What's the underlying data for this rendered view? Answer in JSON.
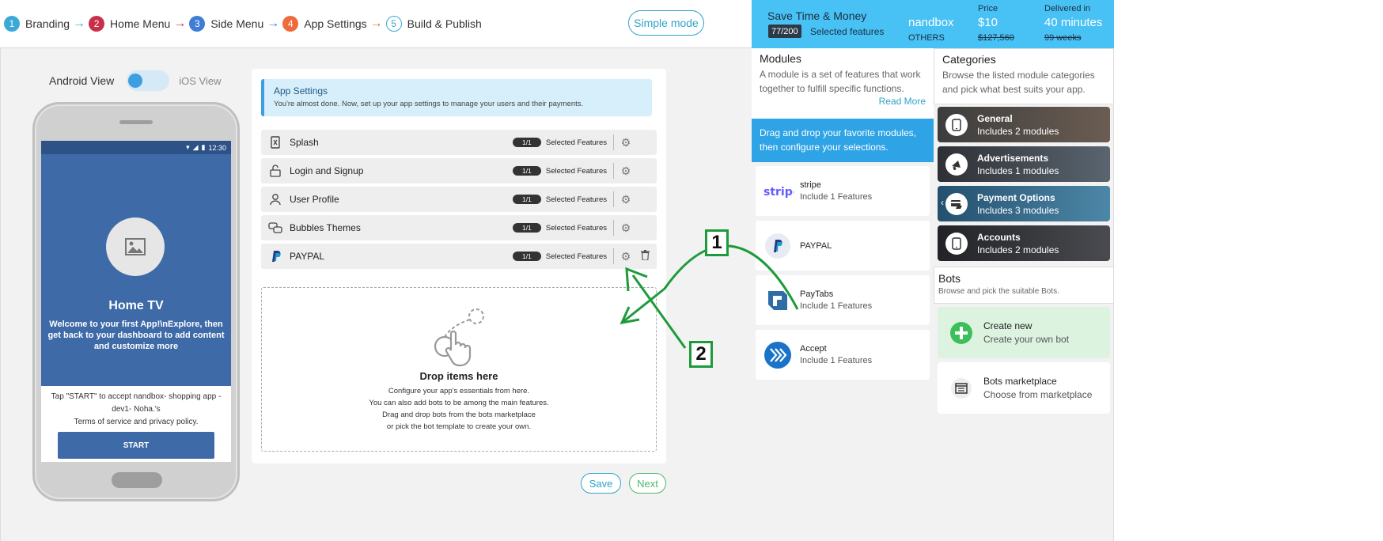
{
  "steps": [
    {
      "num": "1",
      "label": "Branding",
      "color": "#3aa9d6",
      "arrow": "→",
      "arrow_color": "#3aa9d6"
    },
    {
      "num": "2",
      "label": "Home Menu",
      "color": "#c8304a",
      "arrow": "→",
      "arrow_color": "#c8304a"
    },
    {
      "num": "3",
      "label": "Side Menu",
      "color": "#3e7cd6",
      "arrow": "→",
      "arrow_color": "#3e7cd6"
    },
    {
      "num": "4",
      "label": "App Settings",
      "color": "#ee6b3b",
      "arrow": "→",
      "arrow_color": "#ee6b3b"
    },
    {
      "num": "5",
      "label": "Build & Publish",
      "color": "#3aa9d6",
      "arrow": "",
      "arrow_color": ""
    }
  ],
  "simple_mode_label": "Simple mode",
  "view_toggle": {
    "android": "Android View",
    "ios": "iOS View"
  },
  "phone": {
    "time": "12:30",
    "home_title": "Home TV",
    "home_desc": "Welcome to your first App!\\nExplore, then get back to your dashboard to add content and customize more",
    "terms_line1": "Tap \"START\" to accept nandbox- shopping app - dev1- Noha.'s",
    "terms_line2": "Terms of service and privacy policy.",
    "start_label": "START"
  },
  "settings": {
    "title": "App Settings",
    "subtitle": "You're almost done. Now, set up your app settings to manage your users and their payments.",
    "rows": [
      {
        "label": "Splash",
        "icon": "splash-icon",
        "badge": "1/1",
        "selected": "Selected Features"
      },
      {
        "label": "Login and Signup",
        "icon": "login-icon",
        "badge": "1/1",
        "selected": "Selected Features"
      },
      {
        "label": "User Profile",
        "icon": "user-icon",
        "badge": "1/1",
        "selected": "Selected Features"
      },
      {
        "label": "Bubbles Themes",
        "icon": "bubbles-icon",
        "badge": "1/1",
        "selected": "Selected Features"
      },
      {
        "label": "PAYPAL",
        "icon": "paypal-icon",
        "badge": "1/1",
        "selected": "Selected Features"
      }
    ],
    "drop_title": "Drop items here",
    "drop_lines": [
      "Configure your app's essentials from here.",
      "You can also add bots to be among the main features.",
      "Drag and drop bots from the bots marketplace",
      "or pick the bot template to create your own."
    ],
    "save_label": "Save",
    "next_label": "Next"
  },
  "banner": {
    "title": "Save Time & Money",
    "count": "77/200",
    "count_label": "Selected features",
    "nandbox": "nandbox",
    "others": "OTHERS",
    "price_header": "Price",
    "price": "$10",
    "price_old": "$127,560",
    "delivered_header": "Delivered in",
    "delivered": "40 minutes",
    "delivered_old": "99 weeks"
  },
  "modules": {
    "title": "Modules",
    "desc": "A module is a set of features that work together to fulfill specific functions.",
    "read_more": "Read More",
    "drag_text": "Drag and drop your favorite modules, then configure your selections.",
    "items": [
      {
        "name": "stripe",
        "sub": "Include 1 Features",
        "logo": "stripe-logo"
      },
      {
        "name": "PAYPAL",
        "sub": "",
        "logo": "paypal-logo"
      },
      {
        "name": "PayTabs",
        "sub": "Include 1 Features",
        "logo": "paytabs-logo"
      },
      {
        "name": "Accept",
        "sub": "Include 1 Features",
        "logo": "accept-logo"
      }
    ]
  },
  "categories": {
    "title": "Categories",
    "desc": "Browse the listed module categories and pick what best suits your app.",
    "items": [
      {
        "title": "General",
        "sub": "Includes 2 modules",
        "icon": "phone-icon",
        "color": "#4a4a4a"
      },
      {
        "title": "Advertisements",
        "sub": "Includes 1 modules",
        "icon": "megaphone-icon",
        "color": "#3a3f47"
      },
      {
        "title": "Payment Options",
        "sub": "Includes 3 modules",
        "icon": "payment-icon",
        "color": "#2f5a78"
      },
      {
        "title": "Accounts",
        "sub": "Includes 2 modules",
        "icon": "phone-icon",
        "color": "#2d2f33"
      }
    ]
  },
  "bots": {
    "title": "Bots",
    "desc": "Browse and pick the suitable Bots.",
    "create_title": "Create new",
    "create_sub": "Create your own bot",
    "market_title": "Bots marketplace",
    "market_sub": "Choose from marketplace"
  },
  "annotations": {
    "label1": "1",
    "label2": "2",
    "color": "#1d9b3a"
  }
}
